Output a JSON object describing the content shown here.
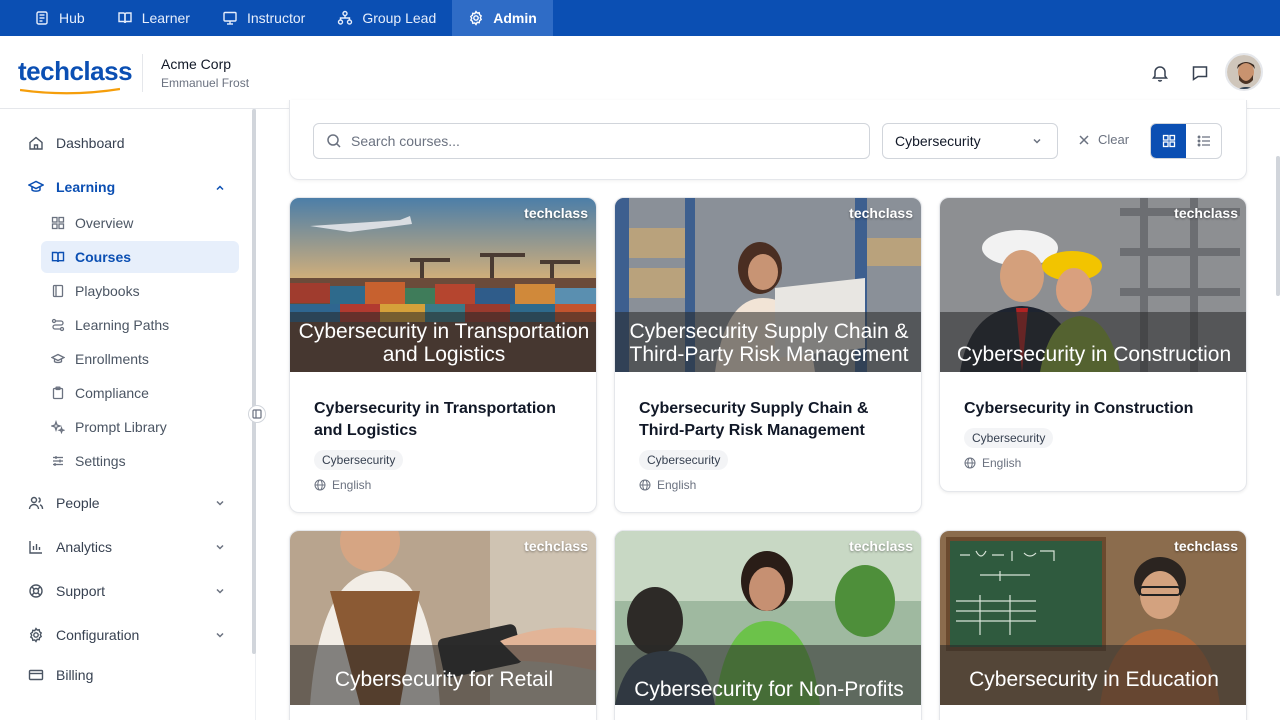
{
  "rolebar": {
    "items": [
      {
        "label": "Hub",
        "icon": "hub-icon"
      },
      {
        "label": "Learner",
        "icon": "book-icon"
      },
      {
        "label": "Instructor",
        "icon": "monitor-icon"
      },
      {
        "label": "Group Lead",
        "icon": "org-chart-icon"
      },
      {
        "label": "Admin",
        "icon": "gear-icon",
        "active": true
      }
    ]
  },
  "header": {
    "logo": "techclass",
    "org_name": "Acme Corp",
    "user_name": "Emmanuel Frost"
  },
  "sidebar": {
    "dashboard": "Dashboard",
    "learning": "Learning",
    "learning_items": [
      "Overview",
      "Courses",
      "Playbooks",
      "Learning Paths",
      "Enrollments",
      "Compliance",
      "Prompt Library",
      "Settings"
    ],
    "people": "People",
    "analytics": "Analytics",
    "support": "Support",
    "configuration": "Configuration",
    "billing": "Billing"
  },
  "filters": {
    "search_placeholder": "Search courses...",
    "category": "Cybersecurity",
    "clear_label": "Clear"
  },
  "courses": [
    {
      "thumb_title": "Cybersecurity in Transportation and Logistics",
      "title": "Cybersecurity in Transportation and Logistics",
      "tag": "Cybersecurity",
      "language": "English",
      "brand": "techclass"
    },
    {
      "thumb_title": "Cybersecurity Supply Chain & Third-Party Risk Management",
      "title": "Cybersecurity Supply Chain & Third-Party Risk Management",
      "tag": "Cybersecurity",
      "language": "English",
      "brand": "techclass"
    },
    {
      "thumb_title": "Cybersecurity in Construction",
      "title": "Cybersecurity in Construction",
      "tag": "Cybersecurity",
      "language": "English",
      "brand": "techclass"
    },
    {
      "thumb_title": "Cybersecurity for Retail",
      "brand": "techclass"
    },
    {
      "thumb_title": "Cybersecurity for Non-Profits",
      "brand": "techclass"
    },
    {
      "thumb_title": "Cybersecurity in Education",
      "brand": "techclass"
    }
  ],
  "colors": {
    "brand": "#0b4fb3",
    "active_bg": "#e7effb"
  }
}
